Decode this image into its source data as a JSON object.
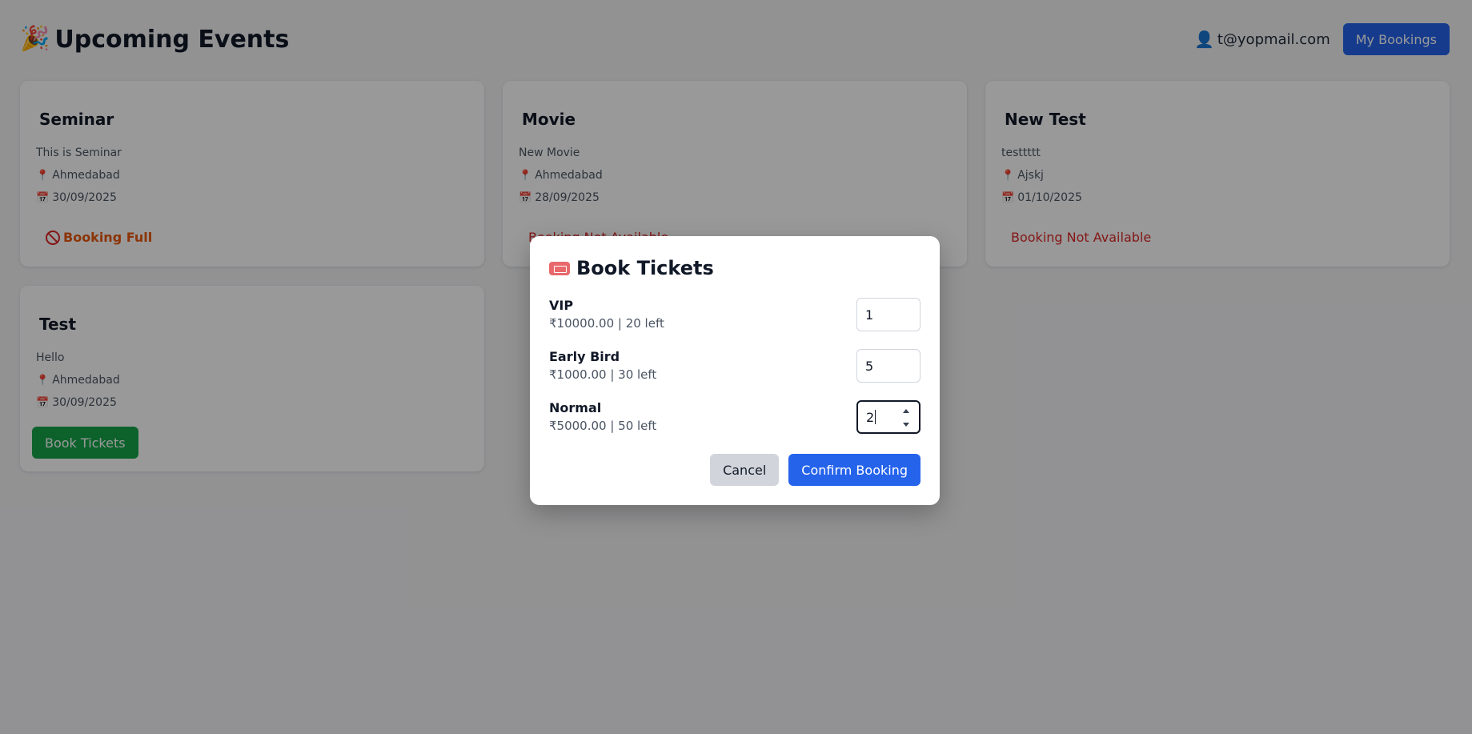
{
  "header": {
    "title": "Upcoming Events",
    "title_icon": "party-popper-icon",
    "user_icon": "user-icon",
    "user_email": "t@yopmail.com",
    "my_bookings_label": "My Bookings"
  },
  "events": [
    {
      "title": "Seminar",
      "description": "This is Seminar",
      "location": "Ahmedabad",
      "date": "30/09/2025",
      "status": "Booking Full"
    },
    {
      "title": "Movie",
      "description": "New Movie",
      "location": "Ahmedabad",
      "date": "28/09/2025",
      "status": "Booking Not Available"
    },
    {
      "title": "New Test",
      "description": "testtttt",
      "location": "Ajskj",
      "date": "01/10/2025",
      "status": "Booking Not Available"
    },
    {
      "title": "Test",
      "description": "Hello",
      "location": "Ahmedabad",
      "date": "30/09/2025",
      "action_label": "Book Tickets"
    }
  ],
  "modal": {
    "title": "Book Tickets",
    "title_icon": "ticket-icon",
    "tickets": [
      {
        "name": "VIP",
        "meta": "₹10000.00 | 20 left",
        "quantity": "1"
      },
      {
        "name": "Early Bird",
        "meta": "₹1000.00 | 30 left",
        "quantity": "5"
      },
      {
        "name": "Normal",
        "meta": "₹5000.00 | 50 left",
        "quantity": "2"
      }
    ],
    "cancel_label": "Cancel",
    "confirm_label": "Confirm Booking"
  },
  "colors": {
    "primary": "#2563eb",
    "success": "#16a34a",
    "danger": "#dc2626",
    "warning": "#ea580c"
  }
}
